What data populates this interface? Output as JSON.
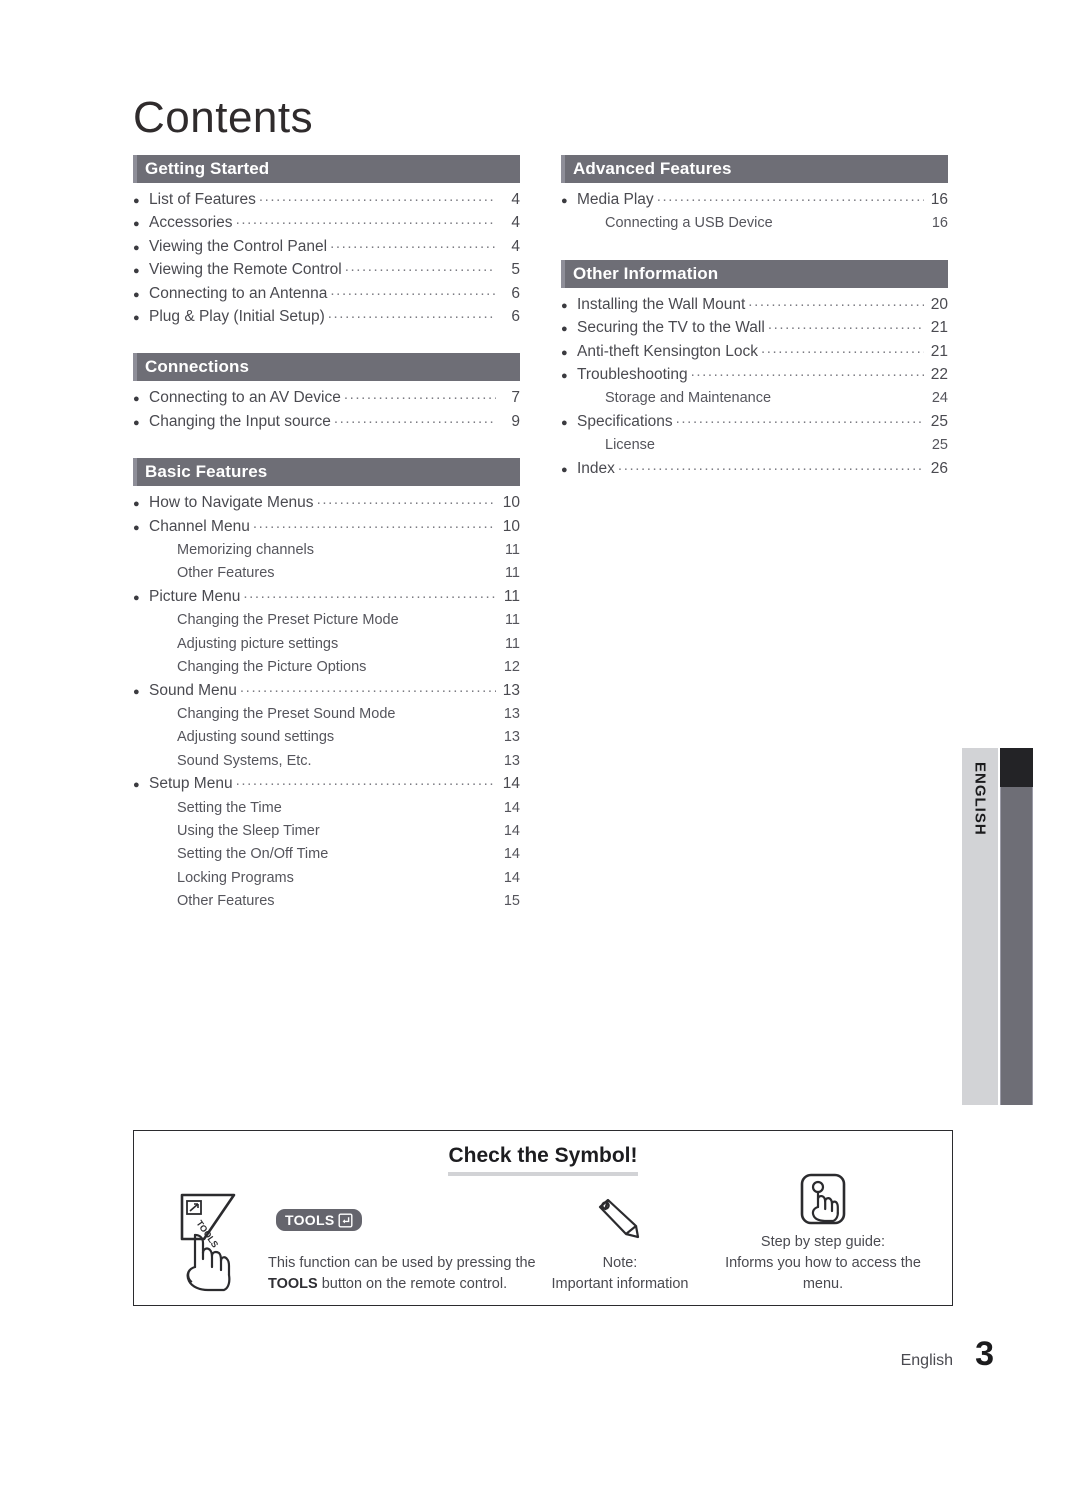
{
  "page": {
    "title": "Contents",
    "footer_language": "English",
    "footer_page_number": "3",
    "side_tab_label": "ENGLISH",
    "colors": {
      "header_bar": "#6e6e76",
      "header_bar_accent": "#8e8e98",
      "header_text": "#ffffff",
      "body_text": "#4a4a50",
      "side_tab_light": "#d2d3d6",
      "side_tab_dark": "#6e6e76",
      "side_tab_marker": "#232326",
      "symbol_underline": "#d2d3d6",
      "tools_badge": "#65656d"
    }
  },
  "left_column": [
    {
      "heading": "Getting Started",
      "entries": [
        {
          "level": 1,
          "title": "List of Features",
          "page": "4"
        },
        {
          "level": 1,
          "title": "Accessories",
          "page": "4"
        },
        {
          "level": 1,
          "title": "Viewing the Control Panel",
          "page": "4"
        },
        {
          "level": 1,
          "title": "Viewing the Remote Control",
          "page": "5"
        },
        {
          "level": 1,
          "title": "Connecting to an Antenna",
          "page": "6"
        },
        {
          "level": 1,
          "title": "Plug & Play (Initial Setup)",
          "page": "6"
        }
      ]
    },
    {
      "heading": "Connections",
      "entries": [
        {
          "level": 1,
          "title": "Connecting to an AV Device",
          "page": "7"
        },
        {
          "level": 1,
          "title": "Changing the Input source",
          "page": "9"
        }
      ]
    },
    {
      "heading": "Basic Features",
      "entries": [
        {
          "level": 1,
          "title": "How to Navigate Menus",
          "page": "10"
        },
        {
          "level": 1,
          "title": "Channel Menu",
          "page": "10"
        },
        {
          "level": 2,
          "title": "Memorizing channels",
          "page": "11"
        },
        {
          "level": 2,
          "title": "Other Features",
          "page": "11"
        },
        {
          "level": 1,
          "title": "Picture Menu",
          "page": "11"
        },
        {
          "level": 2,
          "title": "Changing the Preset Picture Mode",
          "page": "11"
        },
        {
          "level": 2,
          "title": "Adjusting picture settings",
          "page": "11"
        },
        {
          "level": 2,
          "title": "Changing the Picture Options",
          "page": "12"
        },
        {
          "level": 1,
          "title": "Sound Menu",
          "page": "13"
        },
        {
          "level": 2,
          "title": "Changing the Preset Sound Mode",
          "page": "13"
        },
        {
          "level": 2,
          "title": "Adjusting sound settings",
          "page": "13"
        },
        {
          "level": 2,
          "title": "Sound Systems, Etc.",
          "page": "13"
        },
        {
          "level": 1,
          "title": "Setup Menu",
          "page": "14"
        },
        {
          "level": 2,
          "title": "Setting the Time",
          "page": "14"
        },
        {
          "level": 2,
          "title": "Using the Sleep Timer",
          "page": "14"
        },
        {
          "level": 2,
          "title": "Setting the On/Off Time",
          "page": "14"
        },
        {
          "level": 2,
          "title": "Locking Programs",
          "page": "14"
        },
        {
          "level": 2,
          "title": "Other Features",
          "page": "15"
        }
      ]
    }
  ],
  "right_column": [
    {
      "heading": "Advanced Features",
      "entries": [
        {
          "level": 1,
          "title": "Media Play",
          "page": "16"
        },
        {
          "level": 2,
          "title": "Connecting a USB Device",
          "page": "16"
        }
      ]
    },
    {
      "heading": "Other Information",
      "entries": [
        {
          "level": 1,
          "title": "Installing the Wall Mount",
          "page": "20"
        },
        {
          "level": 1,
          "title": "Securing the TV to the Wall",
          "page": "21"
        },
        {
          "level": 1,
          "title": "Anti-theft Kensington Lock",
          "page": "21"
        },
        {
          "level": 1,
          "title": "Troubleshooting",
          "page": "22"
        },
        {
          "level": 2,
          "title": "Storage and Maintenance",
          "page": "24"
        },
        {
          "level": 1,
          "title": "Specifications",
          "page": "25"
        },
        {
          "level": 2,
          "title": "License",
          "page": "25"
        },
        {
          "level": 1,
          "title": "Index",
          "page": "26"
        }
      ]
    }
  ],
  "symbol_box": {
    "title": "Check the Symbol!",
    "tools": {
      "badge_label": "TOOLS",
      "caption_line1_prefix": "This function can be used by pressing the",
      "caption_bold": "TOOLS",
      "caption_line2_suffix": "button on the remote control."
    },
    "note": {
      "caption_line1": "Note:",
      "caption_line2": "Important information"
    },
    "guide": {
      "caption_line1": "Step by step guide:",
      "caption_line2": "Informs you how to access the menu."
    }
  }
}
